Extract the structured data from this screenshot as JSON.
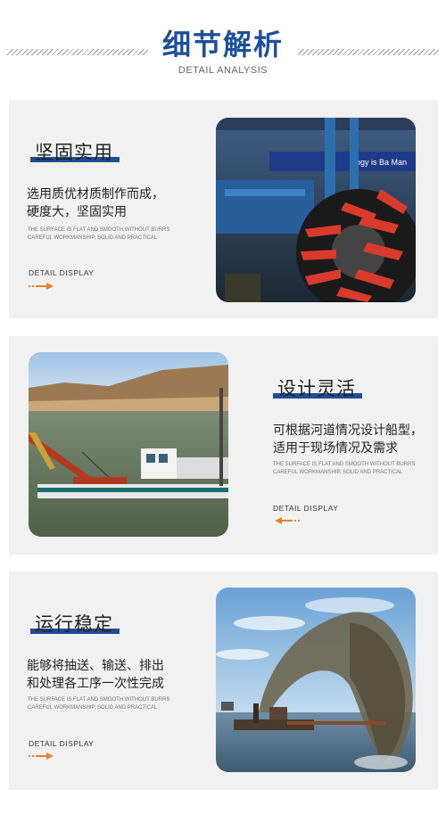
{
  "header": {
    "title": "细节解析",
    "subtitle": "DETAIL ANALYSIS"
  },
  "sections": [
    {
      "title": "坚固实用",
      "desc_line1": "选用质优材质制作而成，",
      "desc_line2": "硬度大，坚固实用",
      "small_line1": "THE SURFACE IS FLAT AND SMOOTH WITHOUT BURRS",
      "small_line2": "CAREFUL WORKMANSHIP, SOLID AND PRACTICAL",
      "detail_label": "DETAIL DISPLAY",
      "image_sign_text": "ology is Ba  Man"
    },
    {
      "title": "设计灵活",
      "desc_line1": "可根据河道情况设计船型，",
      "desc_line2": "适用于现场情况及需求",
      "small_line1": "THE SURFACE IS FLAT AND SMOOTH WITHOUT BURRS",
      "small_line2": "CAREFUL WORKMANSHIP, SOLID AND PRACTICAL",
      "detail_label": "DETAIL DISPLAY"
    },
    {
      "title": "运行稳定",
      "desc_line1": "能够将抽送、输送、排出",
      "desc_line2": "和处理各工序一次性完成",
      "small_line1": "THE SURFACE IS FLAT AND SMOOTH WITHOUT BURRS",
      "small_line2": "CAREFUL WORKMANSHIP, SOLID AND PRACTICAL",
      "detail_label": "DETAIL DISPLAY"
    }
  ],
  "colors": {
    "brand_blue": "#1d4f9c",
    "accent_orange": "#e8832a",
    "card_bg": "#f1f1f1"
  }
}
